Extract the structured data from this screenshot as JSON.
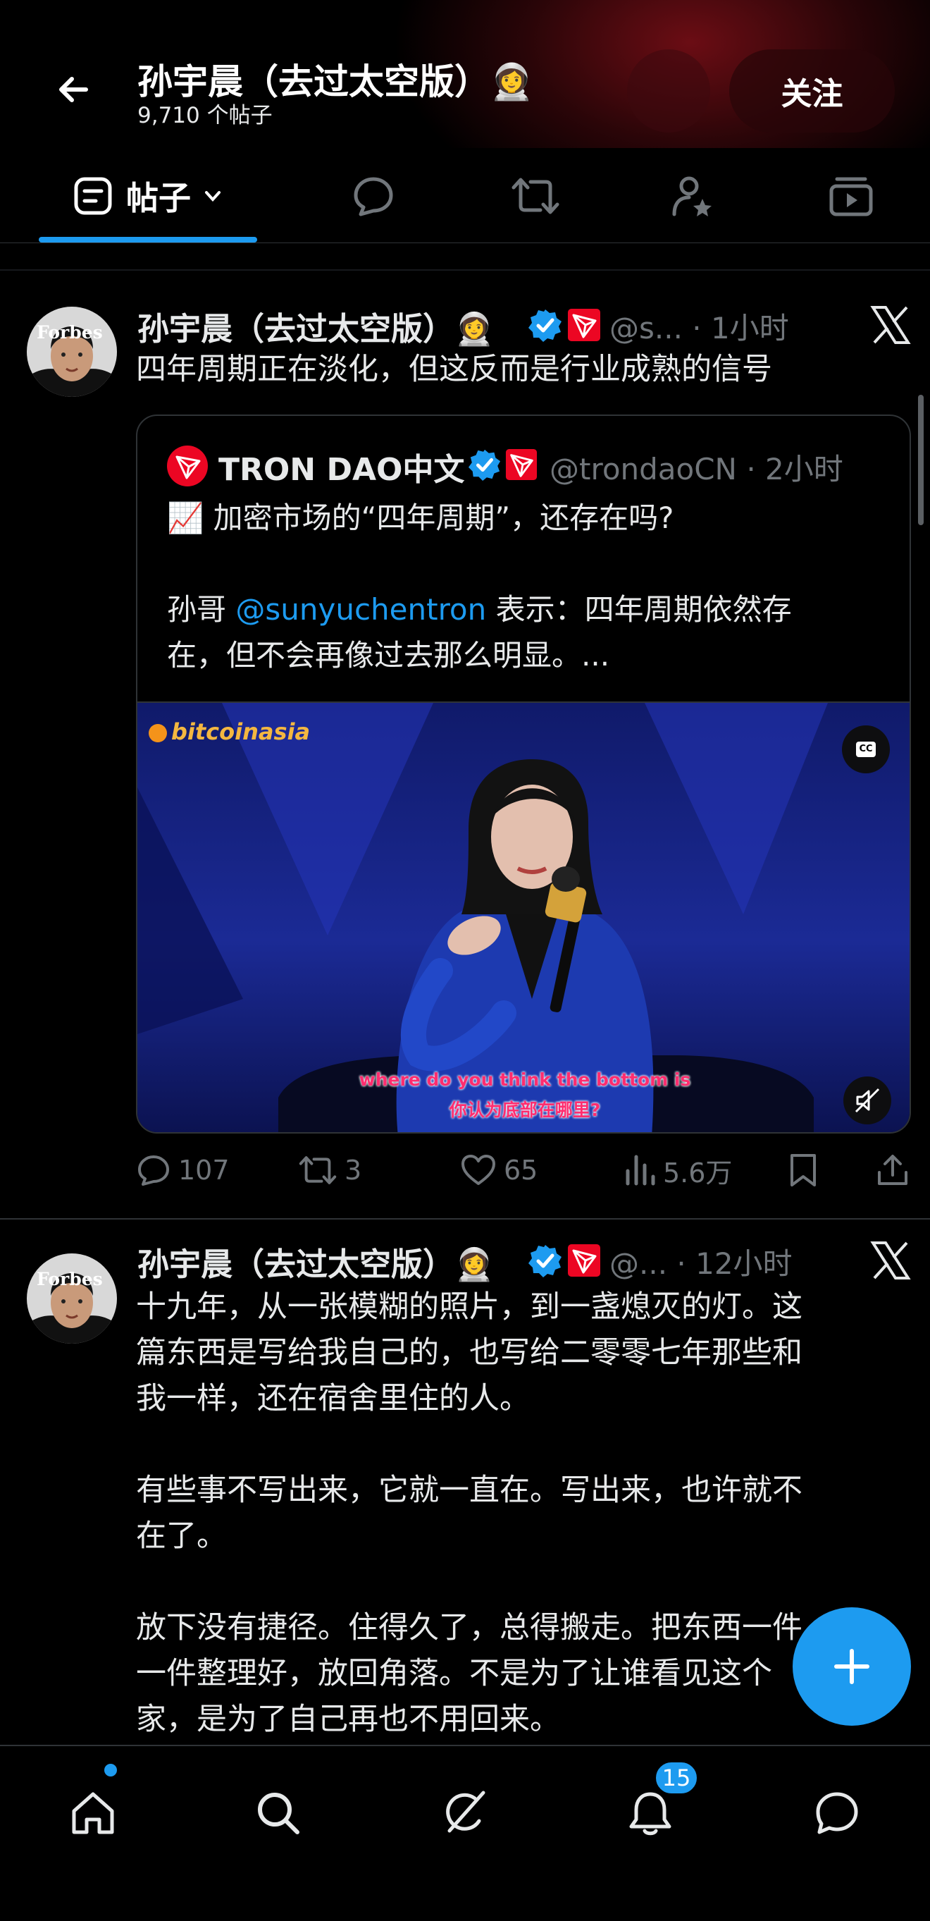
{
  "header": {
    "title": "孙宇晨（去过太空版）👩‍🚀",
    "subtitle": "9,710 个帖子",
    "follow_label": "关注"
  },
  "tabs": {
    "posts_label": "帖子",
    "icons": [
      "posts-icon",
      "replies-icon",
      "reposts-icon",
      "subscribe-icon",
      "media-icon"
    ]
  },
  "posts": [
    {
      "author": "孙宇晨（去过太空版）👩‍🚀",
      "handle_time": "@s... · 1小时",
      "text": "四年周期正在淡化，但这反而是行业成熟的信号",
      "quote": {
        "author": "TRON DAO中文",
        "handle_time": "@trondaoCN · 2小时",
        "line1": "📈 加密市场的“四年周期”，还存在吗?",
        "line2_prefix": "孙哥 ",
        "mention": "@sunyuchentron",
        "line2_suffix": " 表示：四年周期依然存",
        "line3": "在，但不会再像过去那么明显。...",
        "video": {
          "brand": "bitcoinasia",
          "subtitle_en": "where do you think the bottom is",
          "subtitle_zh": "你认为底部在哪里?",
          "cc_label": "CC"
        }
      },
      "stats": {
        "replies": "107",
        "reposts": "3",
        "likes": "65",
        "views": "5.6万"
      }
    },
    {
      "author": "孙宇晨（去过太空版）👩‍🚀",
      "handle_time": "@... · 12小时",
      "para1": [
        "十九年，从一张模糊的照片，到一盏熄灭的灯。这",
        "篇东西是写给我自己的，也写给二零零七年那些和",
        "我一样，还在宿舍里住的人。"
      ],
      "para2": [
        "有些事不写出来，它就一直在。写出来，也许就不",
        "在了。"
      ],
      "para3": [
        "放下没有捷径。住得久了，总得搬走。把东西一件",
        "一件整理好，放回角落。不是为了让谁看见这个",
        "家，是为了自己再也不用回来。"
      ]
    }
  ],
  "avatar_text": "Forbes",
  "bottom_nav": {
    "notifications_count": "15"
  },
  "colors": {
    "accent": "#1d9bf0",
    "muted": "#71767b",
    "tron_red": "#ec0623"
  }
}
